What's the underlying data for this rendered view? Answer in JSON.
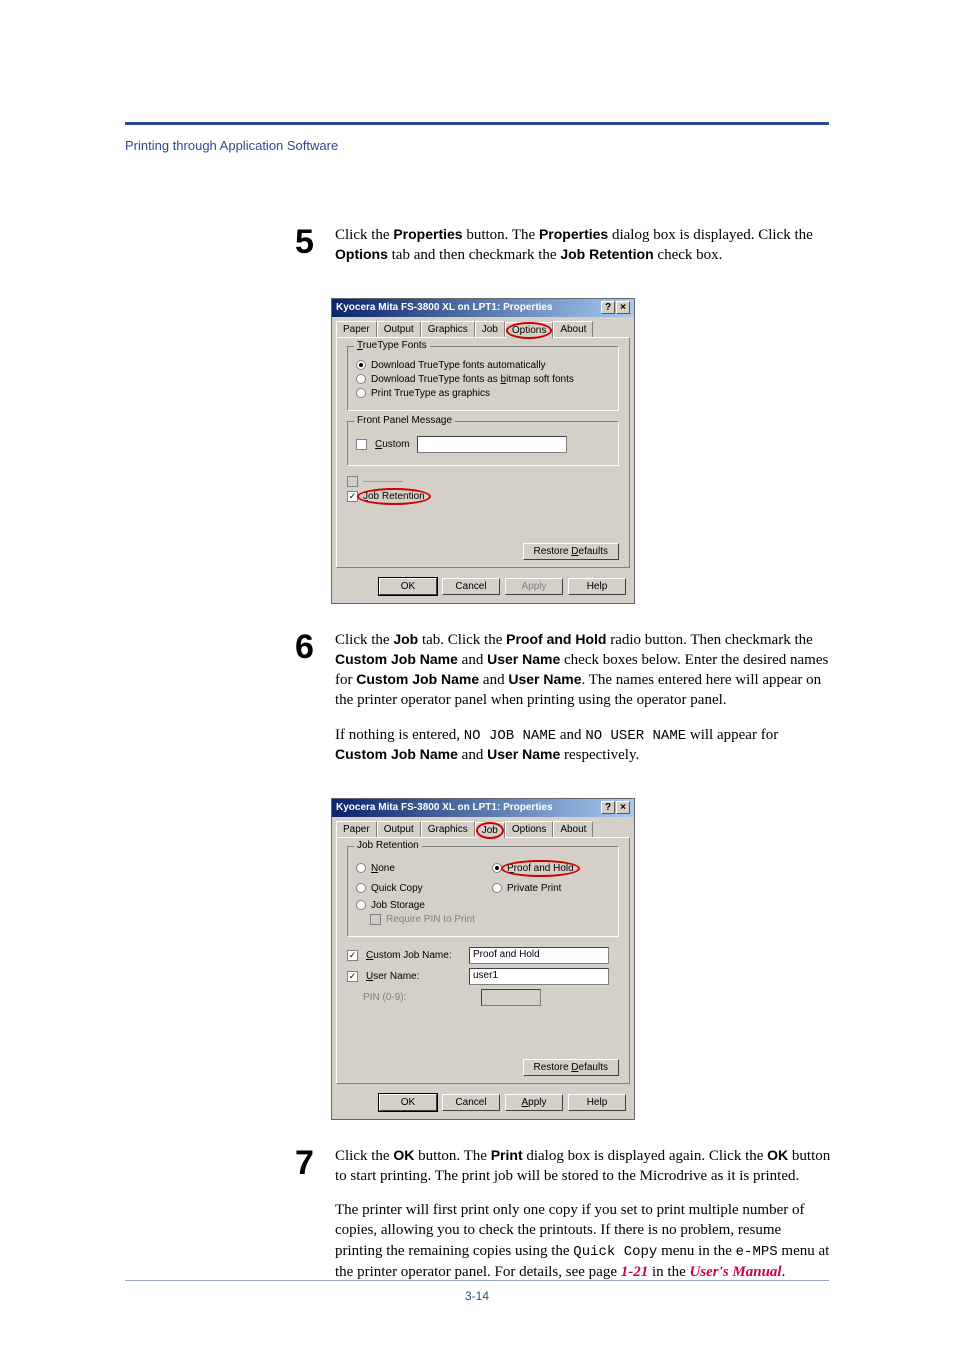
{
  "header": {
    "section_title": "Printing through Application Software"
  },
  "steps": {
    "s5": {
      "num": "5",
      "text_a": "Click the ",
      "prop": "Properties",
      "text_b": " button. The ",
      "prop2": "Properties",
      "text_c": " dialog box is displayed. Click the ",
      "options": "Options",
      "text_d": " tab and then checkmark the ",
      "jobret": "Job Retention",
      "text_e": " check box."
    },
    "s6": {
      "num": "6",
      "p1_a": "Click the ",
      "job": "Job",
      "p1_b": " tab. Click the ",
      "proof": "Proof and Hold",
      "p1_c": " radio button. Then checkmark the ",
      "cjn": "Custom Job Name",
      "p1_d": " and ",
      "un": "User Name",
      "p1_e": " check boxes below. Enter the desired names for ",
      "cjn2": "Custom Job Name",
      "p1_f": " and ",
      "un2": "User Name",
      "p1_g": ". The names entered here will appear on the printer operator panel when printing using the operator panel.",
      "p2_a": "If nothing is entered, ",
      "nojob": "NO JOB NAME",
      "p2_b": " and ",
      "nouser": "NO USER NAME",
      "p2_c": " will appear for ",
      "cjn3": "Custom Job Name",
      "p2_d": " and ",
      "un3": "User Name",
      "p2_e": " respectively."
    },
    "s7": {
      "num": "7",
      "p1_a": "Click the ",
      "ok": "OK",
      "p1_b": " button. The ",
      "print": "Print",
      "p1_c": " dialog box is displayed again. Click the ",
      "ok2": "OK",
      "p1_d": " button to start printing. The print job will be stored to the Microdrive as it is printed.",
      "p2_a": "The printer will first print only one copy if you set to print multiple number of copies, allowing you to check the printouts. If there is no problem, resume printing the remaining copies using the ",
      "quick": "Quick Copy",
      "p2_b": " menu in the ",
      "emps": "e-MPS",
      "p2_c": " menu at the printer operator panel. For details, see page ",
      "link1": "1-21",
      "p2_d": " in the ",
      "link2": "User's Manual",
      "p2_e": "."
    }
  },
  "dialog1": {
    "title": "Kyocera Mita FS-3800 XL on LPT1: Properties",
    "tabs": {
      "paper": "Paper",
      "output": "Output",
      "graphics": "Graphics",
      "job": "Job",
      "options": "Options",
      "about": "About"
    },
    "group_tt": "TrueType Fonts",
    "opt_dl_auto": "Download TrueType fonts automatically",
    "opt_dl_bitmap": "Download TrueType fonts as bitmap soft fonts",
    "opt_print_graphics": "Print TrueType as graphics",
    "group_fpm": "Front Panel Message",
    "custom": "Custom",
    "job_retention": "Job Retention",
    "restore": "Restore Defaults",
    "ok": "OK",
    "cancel": "Cancel",
    "apply": "Apply",
    "help": "Help"
  },
  "dialog2": {
    "title": "Kyocera Mita FS-3800 XL on LPT1: Properties",
    "tabs": {
      "paper": "Paper",
      "output": "Output",
      "graphics": "Graphics",
      "job": "Job",
      "options": "Options",
      "about": "About"
    },
    "group_jr": "Job Retention",
    "none": "None",
    "proof_hold": "Proof and Hold",
    "quick_copy": "Quick Copy",
    "private_print": "Private Print",
    "job_storage": "Job Storage",
    "require_pin": "Require PIN to Print",
    "custom_job_name": "Custom Job Name:",
    "cjn_value": "Proof and Hold",
    "user_name": "User Name:",
    "un_value": "user1",
    "pin_label": "PIN (0-9):",
    "restore": "Restore Defaults",
    "ok": "OK",
    "cancel": "Cancel",
    "apply": "Apply",
    "help": "Help"
  },
  "footer": {
    "page": "3-14"
  }
}
